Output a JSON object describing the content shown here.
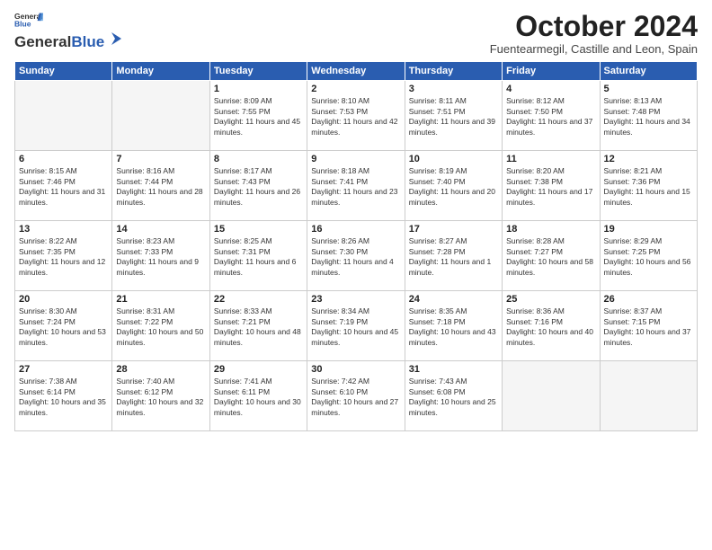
{
  "header": {
    "logo_line1": "General",
    "logo_line2": "Blue",
    "month_title": "October 2024",
    "subtitle": "Fuentearmegil, Castille and Leon, Spain"
  },
  "days_of_week": [
    "Sunday",
    "Monday",
    "Tuesday",
    "Wednesday",
    "Thursday",
    "Friday",
    "Saturday"
  ],
  "weeks": [
    [
      {
        "day": "",
        "empty": true
      },
      {
        "day": "",
        "empty": true
      },
      {
        "day": "1",
        "sunrise": "Sunrise: 8:09 AM",
        "sunset": "Sunset: 7:55 PM",
        "daylight": "Daylight: 11 hours and 45 minutes."
      },
      {
        "day": "2",
        "sunrise": "Sunrise: 8:10 AM",
        "sunset": "Sunset: 7:53 PM",
        "daylight": "Daylight: 11 hours and 42 minutes."
      },
      {
        "day": "3",
        "sunrise": "Sunrise: 8:11 AM",
        "sunset": "Sunset: 7:51 PM",
        "daylight": "Daylight: 11 hours and 39 minutes."
      },
      {
        "day": "4",
        "sunrise": "Sunrise: 8:12 AM",
        "sunset": "Sunset: 7:50 PM",
        "daylight": "Daylight: 11 hours and 37 minutes."
      },
      {
        "day": "5",
        "sunrise": "Sunrise: 8:13 AM",
        "sunset": "Sunset: 7:48 PM",
        "daylight": "Daylight: 11 hours and 34 minutes."
      }
    ],
    [
      {
        "day": "6",
        "sunrise": "Sunrise: 8:15 AM",
        "sunset": "Sunset: 7:46 PM",
        "daylight": "Daylight: 11 hours and 31 minutes."
      },
      {
        "day": "7",
        "sunrise": "Sunrise: 8:16 AM",
        "sunset": "Sunset: 7:44 PM",
        "daylight": "Daylight: 11 hours and 28 minutes."
      },
      {
        "day": "8",
        "sunrise": "Sunrise: 8:17 AM",
        "sunset": "Sunset: 7:43 PM",
        "daylight": "Daylight: 11 hours and 26 minutes."
      },
      {
        "day": "9",
        "sunrise": "Sunrise: 8:18 AM",
        "sunset": "Sunset: 7:41 PM",
        "daylight": "Daylight: 11 hours and 23 minutes."
      },
      {
        "day": "10",
        "sunrise": "Sunrise: 8:19 AM",
        "sunset": "Sunset: 7:40 PM",
        "daylight": "Daylight: 11 hours and 20 minutes."
      },
      {
        "day": "11",
        "sunrise": "Sunrise: 8:20 AM",
        "sunset": "Sunset: 7:38 PM",
        "daylight": "Daylight: 11 hours and 17 minutes."
      },
      {
        "day": "12",
        "sunrise": "Sunrise: 8:21 AM",
        "sunset": "Sunset: 7:36 PM",
        "daylight": "Daylight: 11 hours and 15 minutes."
      }
    ],
    [
      {
        "day": "13",
        "sunrise": "Sunrise: 8:22 AM",
        "sunset": "Sunset: 7:35 PM",
        "daylight": "Daylight: 11 hours and 12 minutes."
      },
      {
        "day": "14",
        "sunrise": "Sunrise: 8:23 AM",
        "sunset": "Sunset: 7:33 PM",
        "daylight": "Daylight: 11 hours and 9 minutes."
      },
      {
        "day": "15",
        "sunrise": "Sunrise: 8:25 AM",
        "sunset": "Sunset: 7:31 PM",
        "daylight": "Daylight: 11 hours and 6 minutes."
      },
      {
        "day": "16",
        "sunrise": "Sunrise: 8:26 AM",
        "sunset": "Sunset: 7:30 PM",
        "daylight": "Daylight: 11 hours and 4 minutes."
      },
      {
        "day": "17",
        "sunrise": "Sunrise: 8:27 AM",
        "sunset": "Sunset: 7:28 PM",
        "daylight": "Daylight: 11 hours and 1 minute."
      },
      {
        "day": "18",
        "sunrise": "Sunrise: 8:28 AM",
        "sunset": "Sunset: 7:27 PM",
        "daylight": "Daylight: 10 hours and 58 minutes."
      },
      {
        "day": "19",
        "sunrise": "Sunrise: 8:29 AM",
        "sunset": "Sunset: 7:25 PM",
        "daylight": "Daylight: 10 hours and 56 minutes."
      }
    ],
    [
      {
        "day": "20",
        "sunrise": "Sunrise: 8:30 AM",
        "sunset": "Sunset: 7:24 PM",
        "daylight": "Daylight: 10 hours and 53 minutes."
      },
      {
        "day": "21",
        "sunrise": "Sunrise: 8:31 AM",
        "sunset": "Sunset: 7:22 PM",
        "daylight": "Daylight: 10 hours and 50 minutes."
      },
      {
        "day": "22",
        "sunrise": "Sunrise: 8:33 AM",
        "sunset": "Sunset: 7:21 PM",
        "daylight": "Daylight: 10 hours and 48 minutes."
      },
      {
        "day": "23",
        "sunrise": "Sunrise: 8:34 AM",
        "sunset": "Sunset: 7:19 PM",
        "daylight": "Daylight: 10 hours and 45 minutes."
      },
      {
        "day": "24",
        "sunrise": "Sunrise: 8:35 AM",
        "sunset": "Sunset: 7:18 PM",
        "daylight": "Daylight: 10 hours and 43 minutes."
      },
      {
        "day": "25",
        "sunrise": "Sunrise: 8:36 AM",
        "sunset": "Sunset: 7:16 PM",
        "daylight": "Daylight: 10 hours and 40 minutes."
      },
      {
        "day": "26",
        "sunrise": "Sunrise: 8:37 AM",
        "sunset": "Sunset: 7:15 PM",
        "daylight": "Daylight: 10 hours and 37 minutes."
      }
    ],
    [
      {
        "day": "27",
        "sunrise": "Sunrise: 7:38 AM",
        "sunset": "Sunset: 6:14 PM",
        "daylight": "Daylight: 10 hours and 35 minutes."
      },
      {
        "day": "28",
        "sunrise": "Sunrise: 7:40 AM",
        "sunset": "Sunset: 6:12 PM",
        "daylight": "Daylight: 10 hours and 32 minutes."
      },
      {
        "day": "29",
        "sunrise": "Sunrise: 7:41 AM",
        "sunset": "Sunset: 6:11 PM",
        "daylight": "Daylight: 10 hours and 30 minutes."
      },
      {
        "day": "30",
        "sunrise": "Sunrise: 7:42 AM",
        "sunset": "Sunset: 6:10 PM",
        "daylight": "Daylight: 10 hours and 27 minutes."
      },
      {
        "day": "31",
        "sunrise": "Sunrise: 7:43 AM",
        "sunset": "Sunset: 6:08 PM",
        "daylight": "Daylight: 10 hours and 25 minutes."
      },
      {
        "day": "",
        "empty": true
      },
      {
        "day": "",
        "empty": true
      }
    ]
  ]
}
